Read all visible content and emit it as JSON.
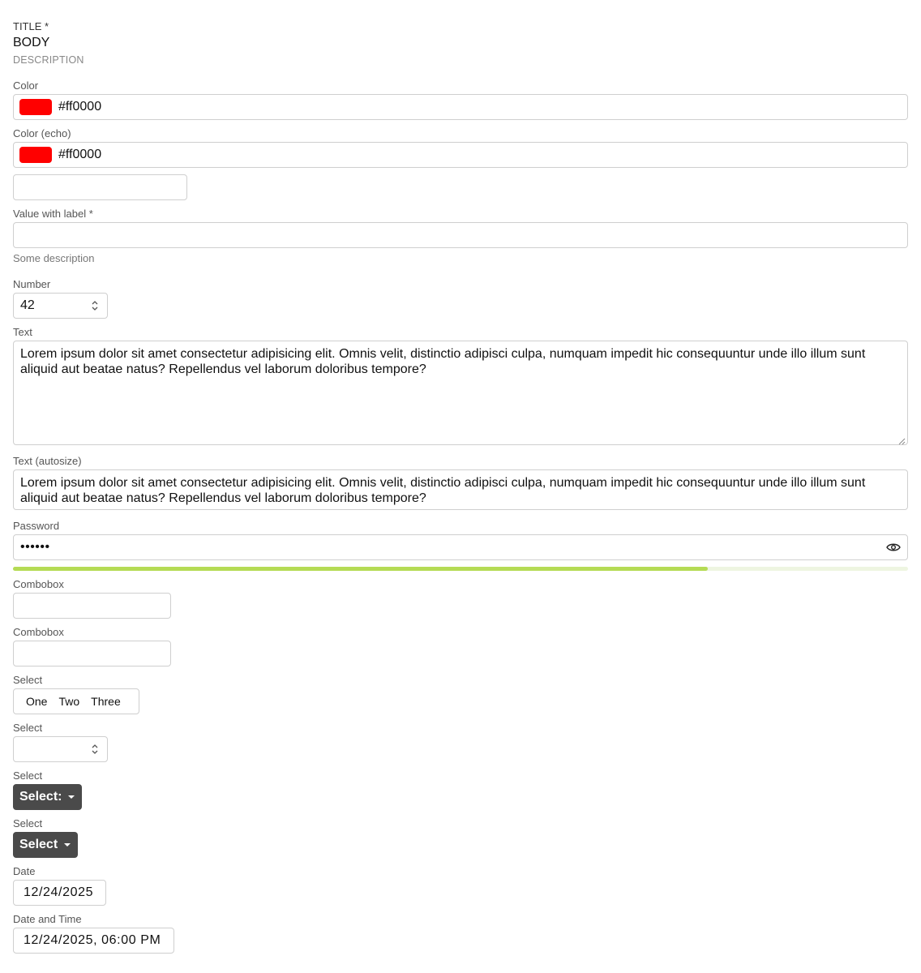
{
  "header": {
    "title": "TITLE *",
    "body": "BODY",
    "description": "DESCRIPTION"
  },
  "color": {
    "label": "Color",
    "value": "#ff0000",
    "swatch": "#ff0000"
  },
  "color_echo": {
    "label": "Color (echo)",
    "value": "#ff0000",
    "swatch": "#ff0000"
  },
  "value_with_label": {
    "label": "Value with label *",
    "value": "",
    "description": "Some description"
  },
  "number": {
    "label": "Number",
    "value": "42"
  },
  "text": {
    "label": "Text",
    "value": "Lorem ipsum dolor sit amet consectetur adipisicing elit. Omnis velit, distinctio adipisci culpa, numquam impedit hic consequuntur unde illo illum sunt aliquid aut beatae natus? Repellendus vel laborum doloribus tempore?"
  },
  "text_autosize": {
    "label": "Text (autosize)",
    "value": "Lorem ipsum dolor sit amet consectetur adipisicing elit. Omnis velit, distinctio adipisci culpa, numquam impedit hic consequuntur unde illo illum sunt aliquid aut beatae natus? Repellendus vel laborum doloribus tempore?"
  },
  "password": {
    "label": "Password",
    "masked": "••••••",
    "strength": 0.776,
    "strength_color": "#b5db55"
  },
  "combobox_1": {
    "label": "Combobox"
  },
  "combobox_2": {
    "label": "Combobox"
  },
  "select_segmented": {
    "label": "Select",
    "options": [
      "One",
      "Two",
      "Three"
    ]
  },
  "select_native": {
    "label": "Select"
  },
  "select_dropdown_1": {
    "label": "Select",
    "button": "Select:"
  },
  "select_dropdown_2": {
    "label": "Select",
    "button": "Select"
  },
  "date": {
    "label": "Date",
    "value": "12/24/2025"
  },
  "datetime": {
    "label": "Date and Time",
    "value": "12/24/2025, 06:00 PM"
  }
}
